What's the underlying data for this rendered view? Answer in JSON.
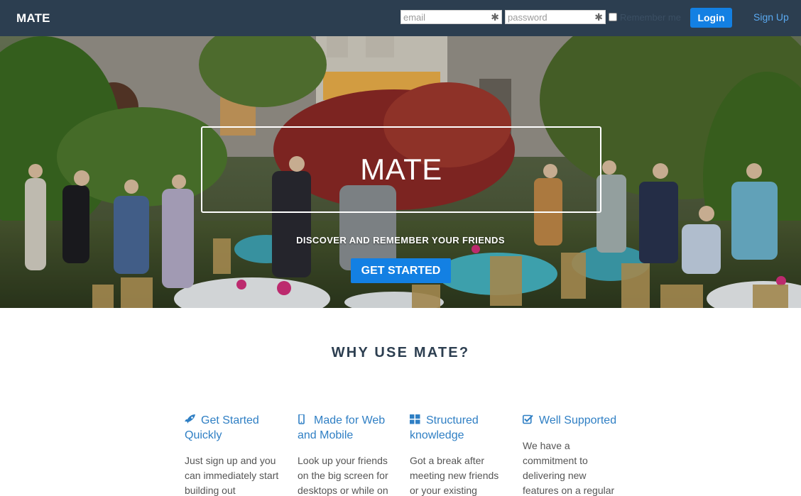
{
  "navbar": {
    "brand": "MATE",
    "email_placeholder": "email",
    "password_placeholder": "password",
    "required_marker": "✱",
    "remember_label": "Remember me",
    "login_label": "Login",
    "signup_label": "Sign Up"
  },
  "hero": {
    "title": "MATE",
    "tagline": "DISCOVER AND REMEMBER YOUR FRIENDS",
    "cta_label": "GET STARTED"
  },
  "features_section": {
    "title": "WHY USE MATE?",
    "items": [
      {
        "icon": "rocket-icon",
        "title": "Get Started Quickly",
        "body": "Just sign up and you can immediately start building out"
      },
      {
        "icon": "mobile-icon",
        "title": "Made for Web and Mobile",
        "body": "Look up your friends on the big screen for desktops or while on"
      },
      {
        "icon": "grid-icon",
        "title": "Structured knowledge",
        "body": "Got a break after meeting new friends or your existing ones?"
      },
      {
        "icon": "checkbox-icon",
        "title": "Well Supported",
        "body": "We have a commitment to delivering new features on a regular"
      }
    ]
  },
  "colors": {
    "navbar_bg": "#2c3e50",
    "primary": "#1380e3",
    "link": "#5aa9f0",
    "feature_title": "#2f7fc4",
    "section_title": "#2c3e50"
  }
}
